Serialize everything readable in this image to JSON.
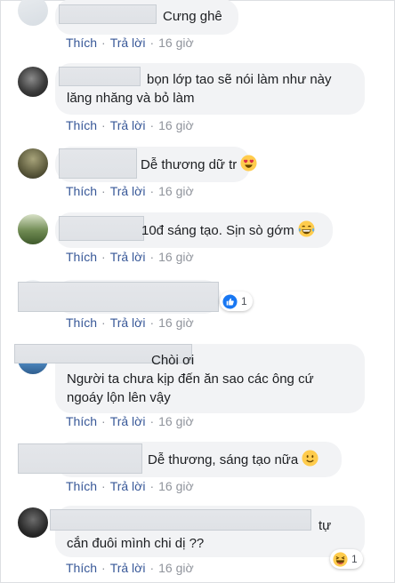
{
  "action_labels": {
    "like": "Thích",
    "reply": "Trả lời",
    "separator": "·",
    "time": "16 giờ"
  },
  "comments": [
    {
      "lines": [
        "Cưng ghê"
      ]
    },
    {
      "lines": [
        "bọn lớp tao sẽ nói làm như này",
        "lăng nhăng và bỏ làm"
      ]
    },
    {
      "lines": [
        "Dễ thương dữ tr"
      ],
      "emoji": "heart-eyes-emoji"
    },
    {
      "lines": [
        "10đ sáng tạo. Sịn sò gớm"
      ],
      "emoji": "tears-of-joy-emoji"
    },
    {
      "lines": [],
      "reaction": {
        "type": "like",
        "count": "1"
      }
    },
    {
      "lines": [
        "Chòi ơi",
        "Người ta chưa kịp đến ăn sao các ông cứ",
        "ngoáy lộn lên vậy"
      ]
    },
    {
      "lines": [
        "Dễ thương, sáng tạo nữa"
      ],
      "emoji": "smiling-emoji"
    },
    {
      "lines": [
        "tự",
        "cắn đuôi mình chi dị ??"
      ],
      "reaction": {
        "type": "haha",
        "count": "1"
      }
    }
  ],
  "colors": {
    "link": "#385898",
    "meta": "#90949c",
    "bubble": "#f2f3f5",
    "text": "#1c1e21",
    "like_blue": "#1877f2"
  }
}
